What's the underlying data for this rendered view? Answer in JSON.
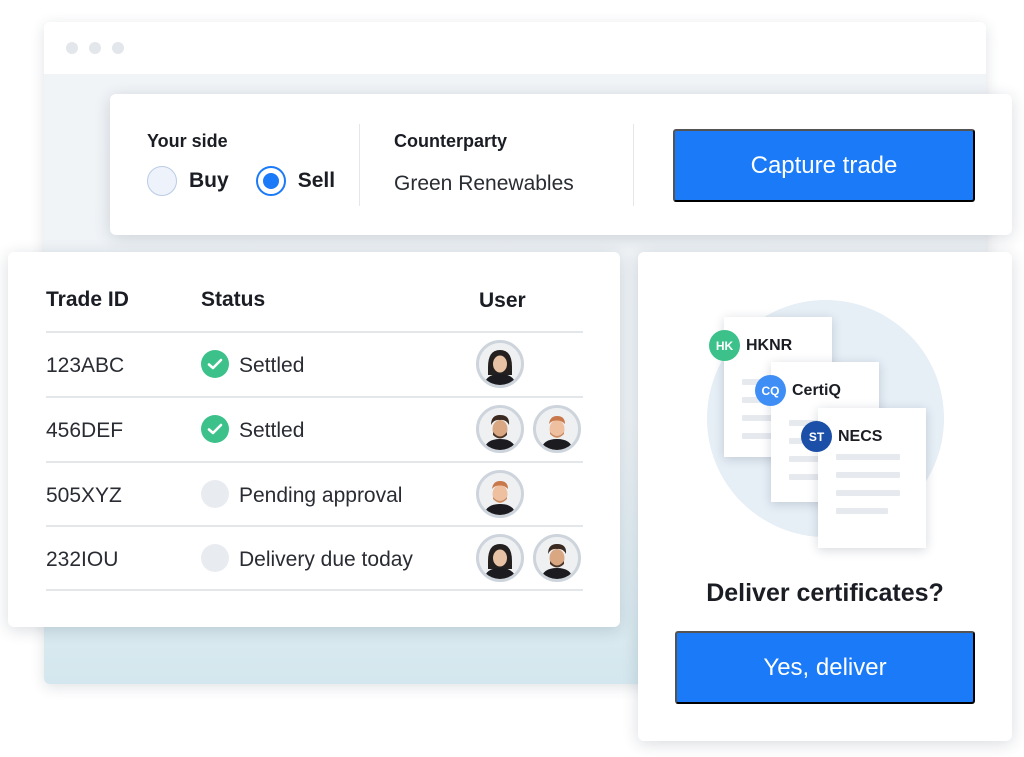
{
  "trade_form": {
    "side_label": "Your side",
    "options": [
      {
        "label": "Buy",
        "selected": false
      },
      {
        "label": "Sell",
        "selected": true
      }
    ],
    "counterparty_label": "Counterparty",
    "counterparty_value": "Green Renewables",
    "capture_button": "Capture trade"
  },
  "trades_table": {
    "columns": [
      "Trade ID",
      "Status",
      "User"
    ],
    "rows": [
      {
        "id": "123ABC",
        "status": "Settled",
        "status_type": "settled",
        "users": [
          "woman-dark-hair"
        ]
      },
      {
        "id": "456DEF",
        "status": "Settled",
        "status_type": "settled",
        "users": [
          "man-curly-hair",
          "man-red-hair"
        ]
      },
      {
        "id": "505XYZ",
        "status": "Pending approval",
        "status_type": "pending",
        "users": [
          "man-red-hair"
        ]
      },
      {
        "id": "232IOU",
        "status": "Delivery due today",
        "status_type": "pending",
        "users": [
          "woman-dark-hair",
          "man-curly-hair"
        ]
      }
    ]
  },
  "certificates": {
    "registries": [
      {
        "code": "HK",
        "name": "HKNR",
        "color": "#3cc18a"
      },
      {
        "code": "CQ",
        "name": "CertiQ",
        "color": "#3e8ef5"
      },
      {
        "code": "ST",
        "name": "NECS",
        "color": "#1b4fa8"
      }
    ],
    "question": "Deliver certificates?",
    "confirm_button": "Yes, deliver"
  },
  "colors": {
    "accent": "#1a7af8",
    "settled": "#3cc18a",
    "pending": "#e8ebf0"
  }
}
